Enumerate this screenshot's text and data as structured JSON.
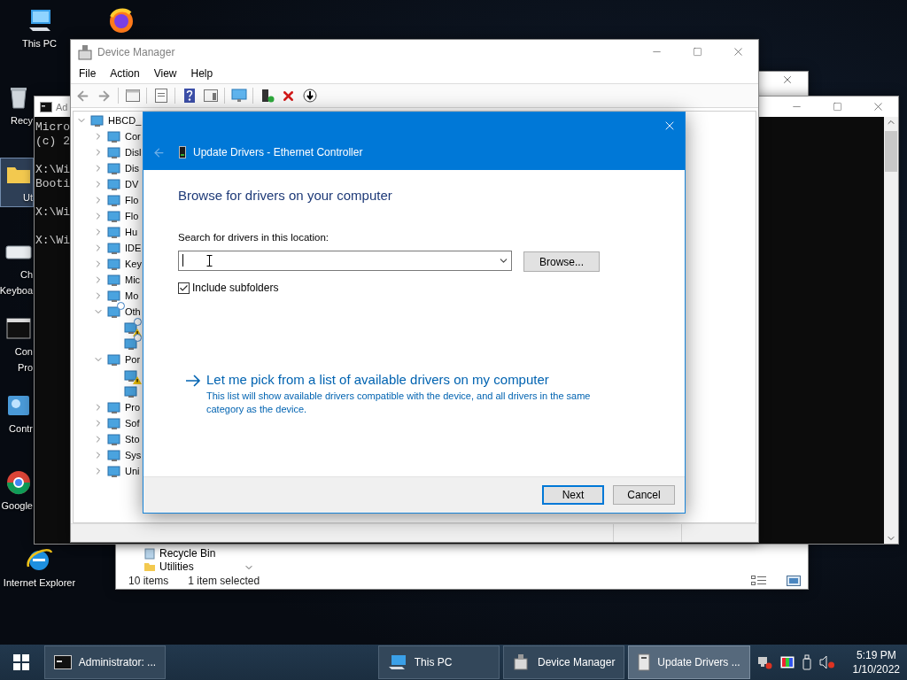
{
  "desktop_icons": [
    {
      "kind": "computer",
      "label": [
        "This PC"
      ],
      "selected": false
    },
    {
      "kind": "recycle",
      "label": [
        "Recy"
      ],
      "selected": false
    },
    {
      "kind": "folder",
      "label": [
        "Ut"
      ],
      "selected": true
    },
    {
      "kind": "keyboard",
      "label": [
        "Ch",
        "Keyboa"
      ],
      "selected": false
    },
    {
      "kind": "console",
      "label": [
        "Con",
        "Pro"
      ],
      "selected": false
    },
    {
      "kind": "control",
      "label": [
        "Contr"
      ],
      "selected": false
    },
    {
      "kind": "chrome",
      "label": [
        "Google"
      ],
      "selected": false
    },
    {
      "kind": "ie",
      "label": [
        "Internet Explorer"
      ],
      "selected": false
    },
    {
      "kind": "firefox",
      "selected": false
    }
  ],
  "explorer": {
    "nav_items": [
      "Recycle Bin",
      "Utilities"
    ],
    "status": [
      "10 items",
      "1 item selected"
    ]
  },
  "console": {
    "title": "Ad",
    "blocks": [
      [
        "Micro",
        "(c) 2"
      ],
      [
        "X:\\Wi",
        "Booti"
      ],
      [
        "X:\\Wi"
      ],
      [
        "X:\\Wi"
      ]
    ]
  },
  "device_manager": {
    "title": "Device Manager",
    "menu": [
      "File",
      "Action",
      "View",
      "Help"
    ],
    "tree": [
      {
        "label": "HBCD_",
        "expanded": true,
        "children": [
          {
            "label": "Cor",
            "expanded": false
          },
          {
            "label": "Disl",
            "expanded": false
          },
          {
            "label": "Dis",
            "expanded": false
          },
          {
            "label": "DV",
            "expanded": false
          },
          {
            "label": "Flo",
            "expanded": false
          },
          {
            "label": "Flo",
            "expanded": false
          },
          {
            "label": "Hu",
            "expanded": false
          },
          {
            "label": "IDE",
            "expanded": false
          },
          {
            "label": "Key",
            "expanded": false
          },
          {
            "label": "Mic",
            "expanded": false
          },
          {
            "label": "Mo",
            "expanded": false
          },
          {
            "label": "Oth",
            "expanded": true,
            "unknown": true,
            "children": [
              {
                "warning": true,
                "unknown": true
              },
              {
                "warning": false,
                "unknown": true
              }
            ]
          },
          {
            "label": "Por",
            "expanded": true,
            "children": [
              {
                "warning": true,
                "unknown": false
              },
              {
                "warning": false,
                "unknown": false
              }
            ]
          },
          {
            "label": "Pro",
            "expanded": false
          },
          {
            "label": "Sof",
            "expanded": false
          },
          {
            "label": "Sto",
            "expanded": false
          },
          {
            "label": "Sys",
            "expanded": false
          },
          {
            "label": "Uni",
            "expanded": false
          }
        ]
      }
    ]
  },
  "dialog": {
    "title": "Update Drivers - Ethernet Controller",
    "back_disabled": true,
    "heading": "Browse for drivers on your computer",
    "location_label": "Search for drivers in this location:",
    "browse_button": "Browse...",
    "include_subfolders": {
      "label": "Include subfolders",
      "checked": true
    },
    "pick_link": {
      "label": "Let me pick from a list of available drivers on my computer",
      "description": "This list will show available drivers compatible with the device, and all drivers in the same category as the device."
    },
    "buttons": [
      {
        "label": "Next",
        "focused": true
      },
      {
        "label": "Cancel",
        "focused": false
      }
    ]
  },
  "taskbar": {
    "items": [
      {
        "kind": "console",
        "label": "Administrator: ...",
        "selected": false
      },
      {
        "kind": "computer",
        "label": "This PC",
        "selected": false
      },
      {
        "kind": "devmgr",
        "label": "Device Manager",
        "selected": false
      },
      {
        "kind": "device",
        "label": "Update Drivers ...",
        "selected": true
      }
    ],
    "time": "5:19 PM",
    "date": "1/10/2022"
  }
}
